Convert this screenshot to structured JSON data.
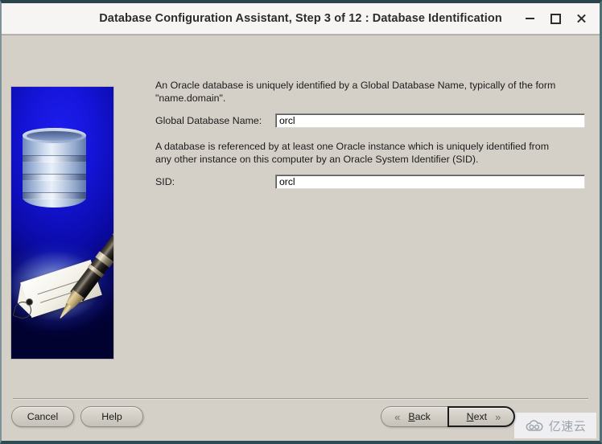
{
  "window": {
    "title": "Database Configuration Assistant, Step 3 of 12 : Database Identification",
    "controls": {
      "minimize": "minimize-icon",
      "maximize": "maximize-icon",
      "close": "close-icon"
    }
  },
  "banner": {
    "alt": "Oracle database cylinder with pen writing on a tag",
    "background_color": "#0b0ba8",
    "cylinder_color": "#b6c6e0"
  },
  "main": {
    "paragraph1": "An Oracle database is uniquely identified by a Global Database Name, typically of the form\n\"name.domain\".",
    "paragraph2": "A database is referenced by at least one Oracle instance which is uniquely identified from\nany other instance on this computer by an Oracle System Identifier (SID).",
    "fields": [
      {
        "label": "Global Database Name:",
        "value": "orcl",
        "placeholder": "",
        "focused": true
      },
      {
        "label": "SID:",
        "value": "orcl",
        "placeholder": "",
        "focused": false
      }
    ]
  },
  "buttons": {
    "cancel": "Cancel",
    "help": "Help",
    "back": "Back",
    "back_mnemonic": "B",
    "back_rest": "ack",
    "next": "Next",
    "next_mnemonic": "N",
    "next_rest": "ext",
    "back_chevron": "«",
    "next_chevron": "»"
  },
  "watermark": {
    "text": "亿速云",
    "icon": "cloud-icon",
    "color": "#9aa3ae"
  }
}
